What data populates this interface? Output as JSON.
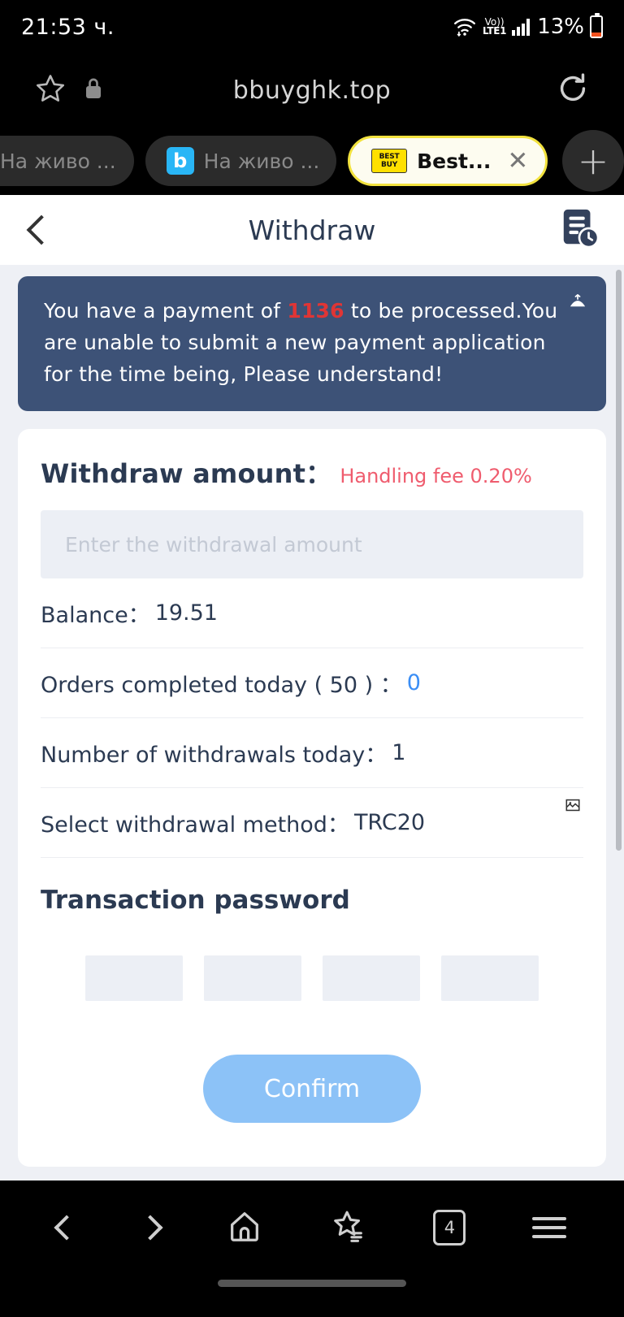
{
  "status_bar": {
    "time": "21:53 ч.",
    "battery_percent": "13%",
    "network_label_top": "Vo))",
    "network_label_bottom": "LTE1",
    "wifi_icon": "wifi-icon",
    "signal_icon": "signal-bars-icon",
    "battery_icon": "battery-icon"
  },
  "browser": {
    "url": "bbuyghk.top",
    "bookmark_icon": "star-outline-icon",
    "lock_icon": "lock-icon",
    "reload_icon": "reload-icon",
    "new_tab_label": "+",
    "tabs": [
      {
        "label": "На живо ...",
        "active": false,
        "favicon": ""
      },
      {
        "label": "На живо ...",
        "active": false,
        "favicon": "b"
      },
      {
        "label": "Best...",
        "active": true,
        "favicon": "bestbuy-logo",
        "close_label": "✕"
      }
    ],
    "bottom_nav": {
      "back": "back-icon",
      "forward": "forward-icon",
      "home": "home-icon",
      "bookmarks": "bookmarks-star-icon",
      "tabs_count": "4",
      "menu": "menu-icon"
    }
  },
  "page": {
    "header": {
      "title": "Withdraw",
      "back_icon": "back-chevron-icon",
      "record_icon": "withdraw-record-icon"
    },
    "notice": {
      "text_before": "You have a payment of ",
      "amount": "1136",
      "text_after": " to be processed.You are unable to submit a new payment application for the time being, Please understand!",
      "icon": "megaphone-icon",
      "bg_color": "#3d5277",
      "amount_color": "#e03535"
    },
    "withdraw": {
      "label": "Withdraw amount：",
      "fee_note": "Handling fee 0.20%",
      "amount_placeholder": "Enter the withdrawal amount",
      "amount_value": "",
      "fee_color": "#ef5c6e"
    },
    "info_rows": [
      {
        "label": "Balance：",
        "value": "19.51",
        "value_color": "#2b3a52"
      },
      {
        "label": "Orders completed today ( 50 ) ：",
        "value": "0",
        "value_color": "#3b8ef5"
      },
      {
        "label": "Number of withdrawals today：",
        "value": "1",
        "value_color": "#2b3a52"
      },
      {
        "label": "Select withdrawal method：",
        "value": "TRC20",
        "value_color": "#2b3a52",
        "trailing_icon": "broken-image-icon"
      }
    ],
    "password": {
      "title": "Transaction password",
      "digits": [
        "",
        "",
        "",
        ""
      ]
    },
    "confirm_button": {
      "label": "Confirm",
      "color": "#8cc2f7"
    },
    "second_card": {
      "banner_color": "#f79421"
    }
  }
}
